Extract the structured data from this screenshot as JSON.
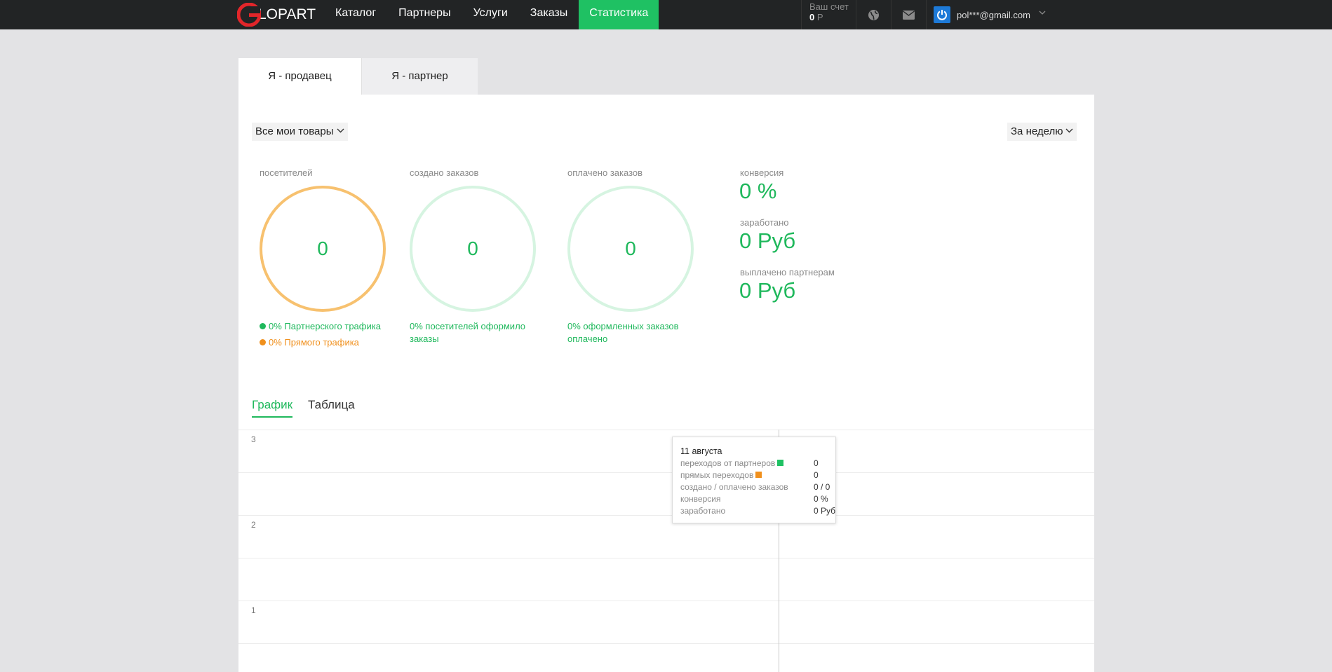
{
  "header": {
    "logo_text": "LOPART",
    "nav": [
      {
        "label": "Каталог"
      },
      {
        "label": "Партнеры"
      },
      {
        "label": "Услуги"
      },
      {
        "label": "Заказы"
      },
      {
        "label": "Статистика",
        "active": true
      }
    ],
    "account": {
      "label": "Ваш счет",
      "balance": "0",
      "currency": "Р"
    },
    "icons": [
      "globe-icon",
      "envelope-icon"
    ],
    "user": {
      "email": "pol***@gmail.com",
      "avatar_icon": "power-icon"
    }
  },
  "tabs": [
    {
      "label": "Я - продавец",
      "active": true
    },
    {
      "label": "Я - партнер"
    }
  ],
  "filters": {
    "products": "Все мои товары",
    "period": "За неделю"
  },
  "metrics": [
    {
      "label": "посетителей",
      "value": "0",
      "ring_color": "#f7c16f",
      "notes": [
        {
          "text": "0% Партнерского трафика",
          "color": "#1fb85c"
        },
        {
          "text": "0% Прямого трафика",
          "color": "#f0901d"
        }
      ]
    },
    {
      "label": "создано заказов",
      "value": "0",
      "ring_color": "#d6f4e1",
      "notes": [
        {
          "text": "0% посетителей оформило заказы",
          "color": "#1fb85c"
        }
      ]
    },
    {
      "label": "оплачено заказов",
      "value": "0",
      "ring_color": "#d6f4e1",
      "notes": [
        {
          "text": "0% оформленных заказов оплачено",
          "color": "#1fb85c"
        }
      ]
    }
  ],
  "kpis": [
    {
      "label": "конверсия",
      "value": "0 %"
    },
    {
      "label": "заработано",
      "value": "0 Руб"
    },
    {
      "label": "выплачено партнерам",
      "value": "0 Руб"
    }
  ],
  "chart_tabs": [
    {
      "label": "График",
      "active": true
    },
    {
      "label": "Таблица"
    }
  ],
  "chart": {
    "y_ticks": [
      "3",
      "2",
      "1"
    ],
    "tooltip": {
      "title": "11 августа",
      "rows": [
        {
          "label": "переходов от партнеров",
          "value": "0",
          "marker_color": "#1fc163"
        },
        {
          "label": "прямых переходов",
          "value": "0",
          "marker_color": "#f0901d"
        },
        {
          "label": "создано / оплачено заказов",
          "value": "0 / 0"
        },
        {
          "label": "конверсия",
          "value": "0 %"
        },
        {
          "label": "заработано",
          "value": "0 Руб"
        }
      ]
    }
  },
  "colors": {
    "accent": "#1fc163",
    "topbar": "#222425",
    "orange": "#f0901d"
  }
}
